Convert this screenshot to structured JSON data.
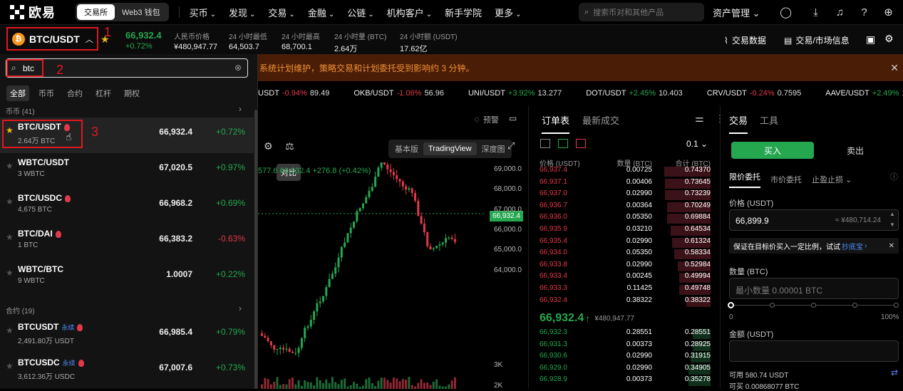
{
  "nav": {
    "brand": "欧易",
    "seg_exchange": "交易所",
    "seg_web3": "Web3 钱包",
    "menu": [
      "买币",
      "发现",
      "交易",
      "金融",
      "公链",
      "机构客户",
      "新手学院",
      "更多"
    ],
    "search_placeholder": "搜索币对和其他产品",
    "asset_mgmt": "资产管理"
  },
  "ticker": {
    "pair": "BTC/USDT",
    "last": "66,932.4",
    "change": "+0.72%",
    "cny_label": "人民币价格",
    "cny": "¥480,947.77",
    "low_label": "24 小时最低",
    "low": "64,503.7",
    "high_label": "24 小时最高",
    "high": "68,700.1",
    "vol_label": "24 小时量 (BTC)",
    "vol": "2.64万",
    "turn_label": "24 小时额 (USDT)",
    "turn": "17.62亿",
    "trade_data": "交易数据",
    "market_info": "交易/市场信息"
  },
  "notice": "系统计划维护，策略交易和计划委托受到影响约 3 分钟。",
  "ribbon": [
    {
      "pair": "USDT",
      "chg": "-0.94%",
      "price": "89.49",
      "up": false
    },
    {
      "pair": "OKB/USDT",
      "chg": "-1.06%",
      "price": "56.96",
      "up": false
    },
    {
      "pair": "UNI/USDT",
      "chg": "+3.92%",
      "price": "13.277",
      "up": true
    },
    {
      "pair": "DOT/USDT",
      "chg": "+2.45%",
      "price": "10.403",
      "up": true
    },
    {
      "pair": "CRV/USDT",
      "chg": "-0.24%",
      "price": "0.7595",
      "up": false
    },
    {
      "pair": "AAVE/USDT",
      "chg": "+2.49%",
      "price": "117.15",
      "up": true
    }
  ],
  "chart": {
    "alert": "预警",
    "views": [
      "基本版",
      "TradingView",
      "深度图"
    ],
    "tooltip": "对比",
    "ohlc_text": "577.6 66,932.4 +276.8 (+0.42%)",
    "y_ticks": [
      "69,000.0",
      "68,000.0",
      "67,000.0",
      "66,000.0",
      "65,000.0",
      "64,000.0",
      "3K",
      "2K"
    ],
    "last_tag": "66,932.4"
  },
  "book": {
    "tab_book": "订单表",
    "tab_trades": "最新成交",
    "precision": "0.1",
    "h_price": "价格 (USDT)",
    "h_qty": "数量 (BTC)",
    "h_total": "合计 (BTC)",
    "asks": [
      [
        "66,937.4",
        "0.00725",
        "0.74370"
      ],
      [
        "66,937.1",
        "0.00406",
        "0.73645"
      ],
      [
        "66,937.0",
        "0.02990",
        "0.73239"
      ],
      [
        "66,936.7",
        "0.00364",
        "0.70249"
      ],
      [
        "66,936.0",
        "0.05350",
        "0.69884"
      ],
      [
        "66,935.9",
        "0.03210",
        "0.64534"
      ],
      [
        "66,935.4",
        "0.02990",
        "0.61324"
      ],
      [
        "66,934.0",
        "0.05350",
        "0.58334"
      ],
      [
        "66,933.8",
        "0.02990",
        "0.52984"
      ],
      [
        "66,933.4",
        "0.00245",
        "0.49994"
      ],
      [
        "66,933.3",
        "0.11425",
        "0.49748"
      ],
      [
        "66,932.4",
        "0.38322",
        "0.38322"
      ]
    ],
    "mid_price": "66,932.4",
    "mid_arrow": "↑",
    "mid_cny": "¥480,947.77",
    "bids": [
      [
        "66,932.3",
        "0.28551",
        "0.28551"
      ],
      [
        "66,931.3",
        "0.00373",
        "0.28925"
      ],
      [
        "66,930.6",
        "0.02990",
        "0.31915"
      ],
      [
        "66,929.0",
        "0.02990",
        "0.34905"
      ],
      [
        "66,928.9",
        "0.00373",
        "0.35278"
      ]
    ]
  },
  "trade": {
    "tab_trade": "交易",
    "tab_tools": "工具",
    "buy": "买入",
    "sell": "卖出",
    "order_types": [
      "限价委托",
      "市价委托",
      "止盈止损"
    ],
    "price_label": "价格 (USDT)",
    "price_value": "66,899.9",
    "price_cny": "≈ ¥480,714.24",
    "hint": "保证在目标价买入一定比例，试试",
    "hint_link": "抄底宝",
    "qty_label": "数量 (BTC)",
    "qty_placeholder": "最小数量 0.00001 BTC",
    "slider_min": "0",
    "slider_max": "100%",
    "amount_label": "金额 (USDT)",
    "avail_label": "可用 580.74 USDT",
    "can_buy": "可买 0.00868077 BTC"
  },
  "dropdown": {
    "query": "btc",
    "filters": [
      "全部",
      "币币",
      "合约",
      "杠杆",
      "期权"
    ],
    "spot_section": "币币 (41)",
    "futures_section": "合约 (19)",
    "spot": [
      {
        "name": "BTC/USDT",
        "vol": "2.64万 BTC",
        "price": "66,932.4",
        "chg": "+0.72%",
        "up": true,
        "hot": true,
        "fav": true
      },
      {
        "name": "WBTC/USDT",
        "vol": "3 WBTC",
        "price": "67,020.5",
        "chg": "+0.97%",
        "up": true,
        "hot": false,
        "fav": false
      },
      {
        "name": "BTC/USDC",
        "vol": "4,675 BTC",
        "price": "66,968.2",
        "chg": "+0.69%",
        "up": true,
        "hot": true,
        "fav": false
      },
      {
        "name": "BTC/DAI",
        "vol": "1 BTC",
        "price": "66,383.2",
        "chg": "-0.63%",
        "up": false,
        "hot": true,
        "fav": false
      },
      {
        "name": "WBTC/BTC",
        "vol": "9 WBTC",
        "price": "1.0007",
        "chg": "+0.22%",
        "up": true,
        "hot": false,
        "fav": false
      }
    ],
    "futures": [
      {
        "name": "BTCUSDT",
        "tag": "永续",
        "vol": "2,491.80万 USDT",
        "price": "66,985.4",
        "chg": "+0.79%",
        "up": true
      },
      {
        "name": "BTCUSDC",
        "tag": "永续",
        "vol": "3,612.36万 USDC",
        "price": "67,007.6",
        "chg": "+0.73%",
        "up": true
      }
    ]
  },
  "annotations": [
    "1",
    "2",
    "3"
  ],
  "colors": {
    "up": "#25a750",
    "down": "#e0394a",
    "accent": "#e2161f",
    "notice_bg": "#4a1d06"
  }
}
